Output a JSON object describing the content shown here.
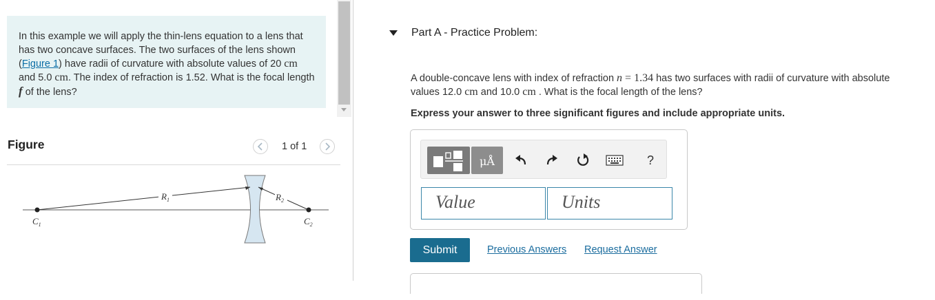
{
  "intro": {
    "text1": "In this example we will apply the thin-lens equation to a lens that has two concave surfaces. The two surfaces of the lens shown (",
    "figure_link": "Figure 1",
    "text2": ") have radii of curvature with absolute values of 20 ",
    "unit1": "cm",
    "text3": " and 5.0 ",
    "unit2": "cm",
    "text4": ". The index of refraction is 1.52. What is the focal length ",
    "var_f": "f",
    "text5": " of the lens?"
  },
  "figure": {
    "title": "Figure",
    "prev_icon": "chevron-left-icon",
    "next_icon": "chevron-right-icon",
    "page_label": "1 of 1",
    "labels": {
      "c1": "C",
      "c1_sub": "1",
      "c2": "C",
      "c2_sub": "2",
      "r1": "R",
      "r1_sub": "1",
      "r2": "R",
      "r2_sub": "2"
    }
  },
  "part_a": {
    "title": "Part A - Practice Problem:",
    "text1": "A double-concave lens with index of refraction ",
    "var_n": "n",
    "eq": " = 1.34",
    "text2": " has two surfaces with radii of curvature with absolute values 12.0 ",
    "unit1": "cm",
    "text3": " and 10.0 ",
    "unit2": "cm",
    "text4": " . What is the focal length of the lens?",
    "instructions": "Express your answer to three significant figures and include appropriate units."
  },
  "toolbar": {
    "units_label": "μÅ",
    "help_label": "?",
    "icons": [
      "templates-icon",
      "units-icon",
      "undo-icon",
      "redo-icon",
      "reset-icon",
      "keyboard-icon",
      "help-icon"
    ]
  },
  "answer": {
    "value_placeholder": "Value",
    "units_placeholder": "Units"
  },
  "actions": {
    "submit_label": "Submit",
    "previous_answers_label": "Previous Answers",
    "request_answer_label": "Request Answer"
  },
  "colors": {
    "intro_bg": "#e7f3f4",
    "link": "#1a6c9e",
    "submit_bg": "#1a6c8f",
    "input_border": "#3a86a9",
    "lens_fill": "#d6e6f1"
  }
}
